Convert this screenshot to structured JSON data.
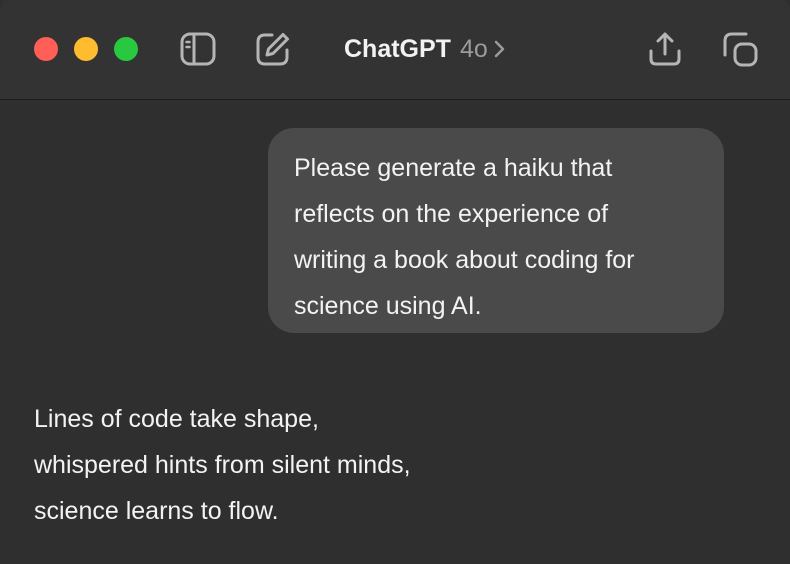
{
  "window": {
    "title": "ChatGPT",
    "model": "4o",
    "traffic_lights": [
      "close",
      "minimize",
      "maximize"
    ],
    "colors": {
      "background": "#2f2f2f",
      "titlebar": "#333333",
      "user_bubble": "#4a4a4a",
      "text": "#f3f3f3",
      "muted_text": "#9b9b9b"
    }
  },
  "toolbar": {
    "sidebar_toggle_icon": "sidebar-icon",
    "new_chat_icon": "compose-icon",
    "chevron_icon": "chevron-right-icon",
    "share_icon": "share-icon",
    "window_icon": "new-window-icon"
  },
  "conversation": {
    "user_message": {
      "lines": [
        "Please generate a haiku that",
        "reflects on the experience of",
        "writing a book about coding for",
        "science using AI."
      ]
    },
    "assistant_message": {
      "lines": [
        "Lines of code take shape,",
        "whispered hints from silent minds,",
        "science learns to flow."
      ]
    }
  }
}
